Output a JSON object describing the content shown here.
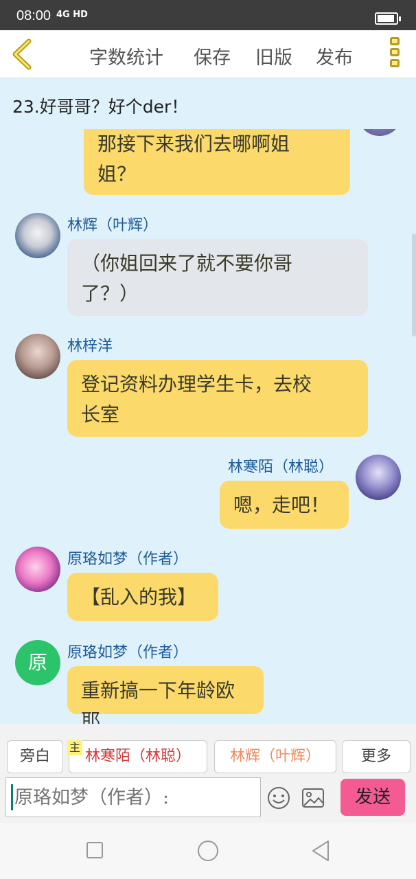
{
  "status": {
    "time": "08:00",
    "signal": "4G HD"
  },
  "toolbar": {
    "word_count": "字数统计",
    "save": "保存",
    "old_version": "旧版",
    "publish": "发布"
  },
  "chapter_title": "23.好哥哥？好个der！",
  "messages": [
    {
      "text": "那接下来我们去哪啊姐姐？",
      "line1": "那接下来我们去哪啊姐",
      "line2": "姐？",
      "color": "#fbd96b"
    },
    {
      "name": "林辉（叶辉）",
      "line1": "（你姐回来了就不要你哥",
      "line2": "了？）",
      "color": "#e3e6ea"
    },
    {
      "name": "林梓洋",
      "line1": "登记资料办理学生卡，去校",
      "line2": "长室",
      "color": "#fbd96b"
    },
    {
      "name": "林寒陌（林聪）",
      "line1": "嗯，走吧！",
      "color": "#fbd96b"
    },
    {
      "name": "原珞如梦（作者）",
      "line1": "【乱入的我】",
      "color": "#fbd96b"
    },
    {
      "name": "原珞如梦（作者）",
      "line1": "重新搞一下年龄欧耶",
      "avatar_char": "原",
      "color": "#fbd96b"
    }
  ],
  "roles": {
    "narration": "旁白",
    "main_badge": "主",
    "role1": "林寒陌（林聪）",
    "role2": "林辉（叶辉）",
    "more": "更多"
  },
  "composer": {
    "placeholder": "原珞如梦（作者）:",
    "send": "发送"
  },
  "colors": {
    "accent_send": "#f45b93",
    "role1_text": "#d23b3b",
    "role2_text": "#f08a5d",
    "name_blue": "#1f5c9a"
  }
}
